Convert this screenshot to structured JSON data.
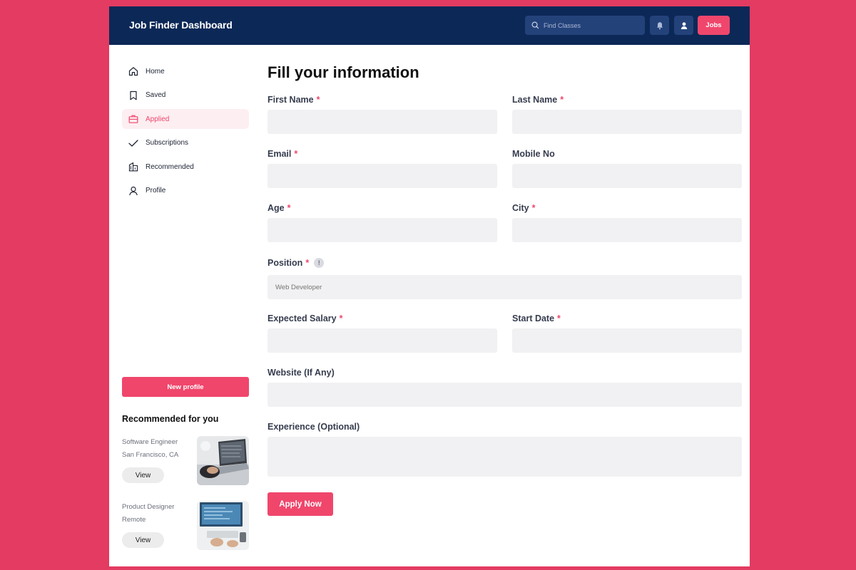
{
  "header": {
    "title": "Job Finder Dashboard",
    "search_placeholder": "Find Classes",
    "jobs_label": "Jobs"
  },
  "sidebar": {
    "items": [
      {
        "label": "Home",
        "icon": "home-icon"
      },
      {
        "label": "Saved",
        "icon": "bookmark-icon"
      },
      {
        "label": "Applied",
        "icon": "briefcase-icon",
        "active": true
      },
      {
        "label": "Subscriptions",
        "icon": "check-icon"
      },
      {
        "label": "Recommended",
        "icon": "building-icon"
      },
      {
        "label": "Profile",
        "icon": "user-icon"
      }
    ],
    "new_profile_label": "New profile",
    "recommended_title": "Recommended for you",
    "recommended": [
      {
        "role": "Software Engineer",
        "location": "San Francisco, CA",
        "button": "View"
      },
      {
        "role": "Product Designer",
        "location": "Remote",
        "button": "View"
      }
    ]
  },
  "form": {
    "title": "Fill your information",
    "fields": {
      "first_name": {
        "label": "First Name",
        "value": ""
      },
      "last_name": {
        "label": "Last Name",
        "value": ""
      },
      "email": {
        "label": "Email",
        "value": ""
      },
      "mobile": {
        "label": "Mobile No",
        "value": ""
      },
      "age": {
        "label": "Age",
        "value": ""
      },
      "city": {
        "label": "City",
        "value": ""
      },
      "position": {
        "label": "Position",
        "placeholder": "Web Developer",
        "info": "!"
      },
      "expected_salary": {
        "label": "Expected Salary",
        "value": ""
      },
      "start_date": {
        "label": "Start Date",
        "value": ""
      },
      "website": {
        "label": "Website (If Any)",
        "value": ""
      },
      "experience": {
        "label": "Experience (Optional)",
        "value": ""
      }
    },
    "required_marker": "*",
    "submit_label": "Apply Now"
  },
  "colors": {
    "background": "#e33b61",
    "header": "#0c2857",
    "accent": "#f0466c",
    "field": "#f1f1f3"
  }
}
